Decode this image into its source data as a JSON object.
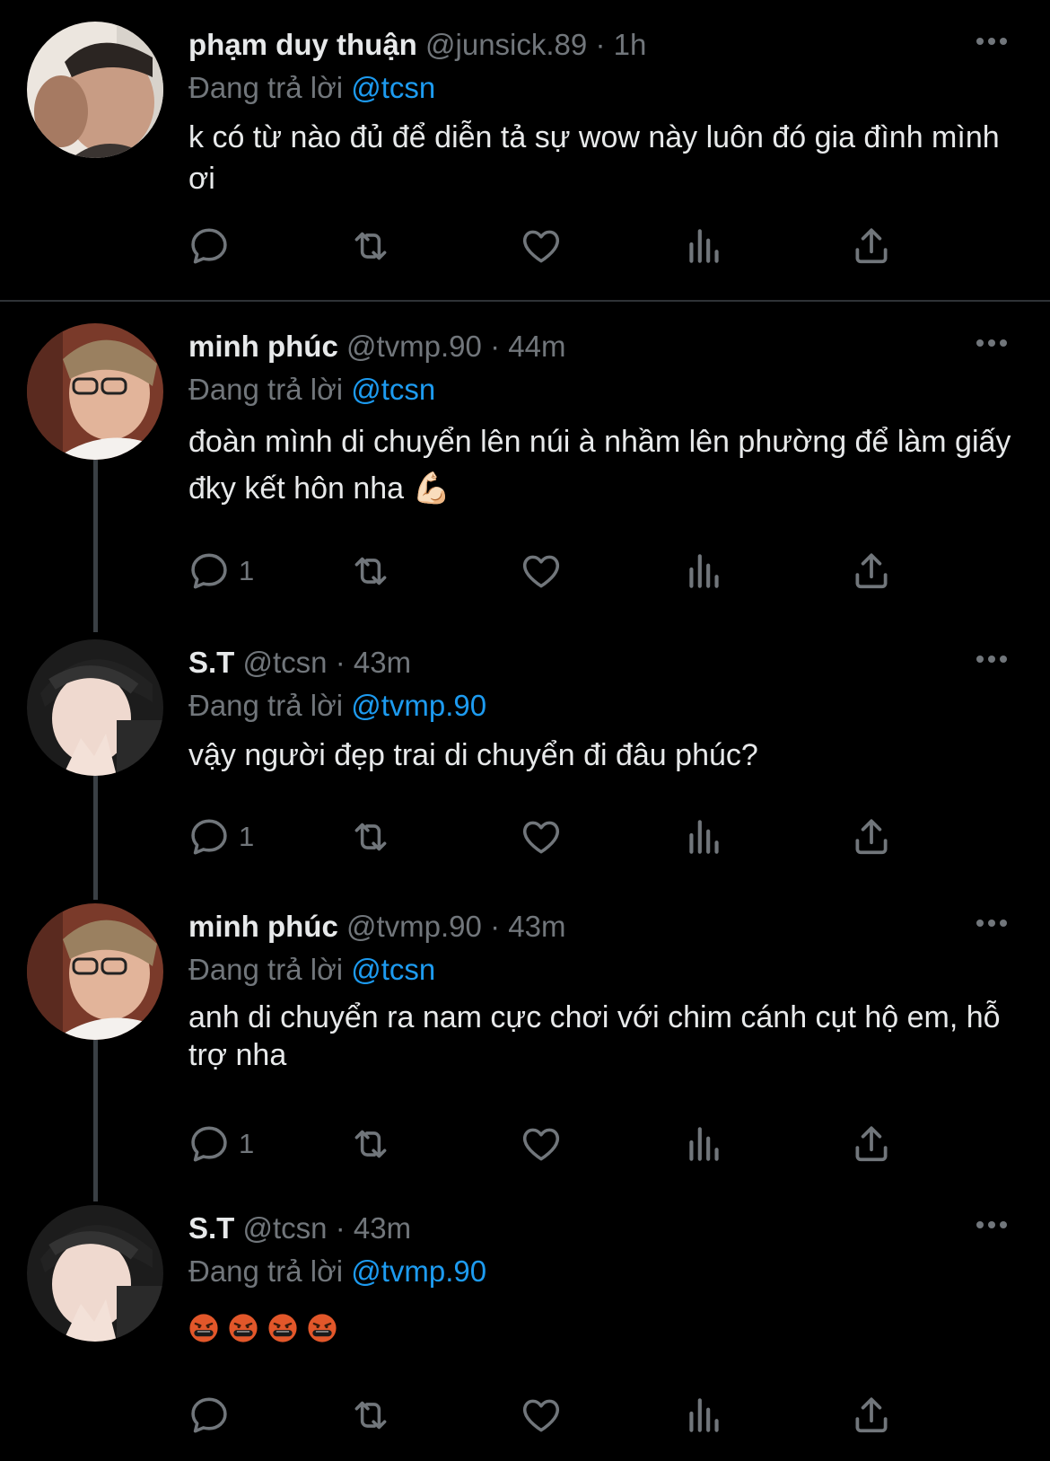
{
  "reply_prefix": "Đang trả lời",
  "tweets": [
    {
      "name": "phạm duy thuận",
      "handle": "@junsick.89",
      "time": "1h",
      "reply_to": "@tcsn",
      "text": "k có từ nào đủ để diễn tả sự wow này luôn đó gia đình mình ơi",
      "reply_count": ""
    },
    {
      "name": "minh phúc",
      "handle": "@tvmp.90",
      "time": "44m",
      "reply_to": "@tcsn",
      "text": "đoàn mình di chuyển lên núi à nhầm lên phường để làm giấy đky kết hôn nha 💪🏻",
      "reply_count": "1"
    },
    {
      "name": "S.T",
      "handle": "@tcsn",
      "time": "43m",
      "reply_to": "@tvmp.90",
      "text": "vậy người đẹp trai di chuyển đi đâu phúc?",
      "reply_count": "1"
    },
    {
      "name": "minh phúc",
      "handle": "@tvmp.90",
      "time": "43m",
      "reply_to": "@tcsn",
      "text": "anh di chuyển ra nam cực chơi với chim cánh cụt hộ em, hỗ trợ nha",
      "reply_count": "1"
    },
    {
      "name": "S.T",
      "handle": "@tcsn",
      "time": "43m",
      "reply_to": "@tvmp.90",
      "text": "🤬🤬🤬🤬",
      "reply_count": ""
    }
  ],
  "icons": {
    "reply": "reply-icon",
    "retweet": "retweet-icon",
    "like": "heart-icon",
    "views": "views-icon",
    "share": "share-icon",
    "more": "more-icon"
  },
  "colors": {
    "background": "#000000",
    "text": "#e7e9ea",
    "muted": "#71767b",
    "mention": "#1d9bf0"
  }
}
